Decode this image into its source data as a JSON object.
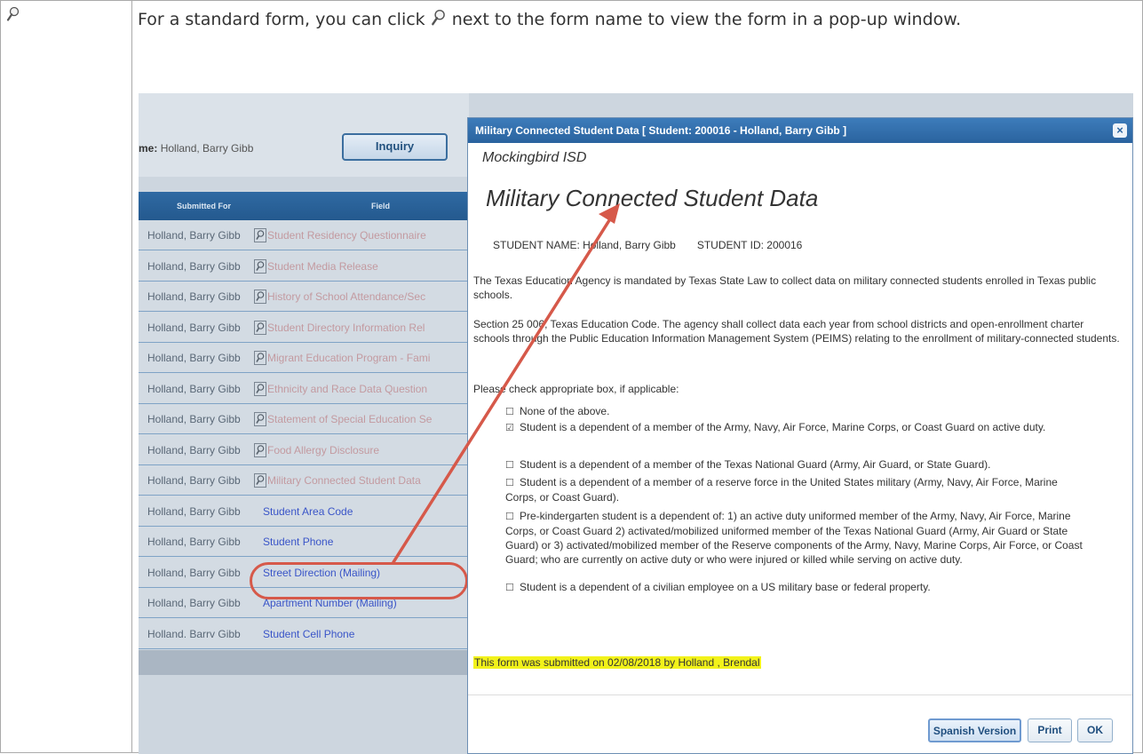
{
  "description": {
    "text_before": "For a standard form, you can click ",
    "text_after": " next to the form name to view the form in a pop-up window."
  },
  "background_page": {
    "student_label": "me:",
    "student_name": "Holland, Barry Gibb",
    "inquiry_button": "Inquiry",
    "grid_headers": {
      "submitted_for": "Submitted For",
      "field": "Field"
    },
    "rows": [
      {
        "who": "Holland, Barry Gibb",
        "field": "Student Residency Questionnaire",
        "icon": true
      },
      {
        "who": "Holland, Barry Gibb",
        "field": "Student Media Release",
        "icon": true
      },
      {
        "who": "Holland, Barry Gibb",
        "field": "History of School Attendance/Sec",
        "icon": true
      },
      {
        "who": "Holland, Barry Gibb",
        "field": "Student Directory Information Rel",
        "icon": true
      },
      {
        "who": "Holland, Barry Gibb",
        "field": "Migrant Education Program - Fami",
        "icon": true
      },
      {
        "who": "Holland, Barry Gibb",
        "field": "Ethnicity and Race Data Question",
        "icon": true
      },
      {
        "who": "Holland, Barry Gibb",
        "field": "Statement of Special Education Se",
        "icon": true
      },
      {
        "who": "Holland, Barry Gibb",
        "field": "Food Allergy Disclosure",
        "icon": true
      },
      {
        "who": "Holland, Barry Gibb",
        "field": "Military Connected Student Data",
        "icon": true
      },
      {
        "who": "Holland, Barry Gibb",
        "field": "Student Area Code",
        "icon": false
      },
      {
        "who": "Holland, Barry Gibb",
        "field": "Student Phone",
        "icon": false
      },
      {
        "who": "Holland, Barry Gibb",
        "field": "Street Direction (Mailing)",
        "icon": false
      },
      {
        "who": "Holland, Barry Gibb",
        "field": "Apartment Number (Mailing)",
        "icon": false
      },
      {
        "who": "Holland. Barrv Gibb",
        "field": "Student Cell Phone",
        "icon": false
      }
    ]
  },
  "dialog": {
    "title": "Military Connected Student Data [ Student: 200016 - Holland, Barry Gibb ]",
    "close_glyph": "×",
    "district": "Mockingbird ISD",
    "form_title": "Military Connected Student Data",
    "student_name": "STUDENT NAME: Holland, Barry Gibb",
    "student_id": "STUDENT ID: 200016",
    "para1": "The Texas Education Agency is mandated by Texas State Law to collect data on military connected students enrolled in Texas public schools.",
    "para2": "Section 25 006, Texas Education Code. The agency shall collect data each year from school districts and open-enrollment charter schools through the Public Education Information Management System (PEIMS) relating to the enrollment of military-connected students.",
    "prompt": "Please check appropriate box, if applicable:",
    "options": [
      {
        "checked": false,
        "text": "None of the above."
      },
      {
        "checked": true,
        "text": "Student is a dependent of a member of the Army, Navy, Air Force, Marine Corps, or Coast Guard on active duty."
      },
      {
        "checked": false,
        "text": "Student is a dependent of a member of the Texas National Guard (Army, Air Guard, or State Guard)."
      },
      {
        "checked": false,
        "text": "Student is a dependent of a member of a reserve force in the United States military (Army, Navy, Air Force, Marine Corps, or Coast Guard)."
      },
      {
        "checked": false,
        "text": "Pre-kindergarten student is a dependent of: 1) an active duty uniformed member of the Army, Navy, Air Force, Marine Corps, or Coast Guard 2) activated/mobilized uniformed member of the Texas National Guard (Army, Air Guard or State Guard) or 3) activated/mobilized member of the Reserve components of the Army, Navy, Marine Corps, Air Force, or Coast Guard; who are currently on active duty or who were injured or killed while serving on active duty."
      },
      {
        "checked": false,
        "text": "Student is a dependent of a civilian employee on a US military base or federal property."
      }
    ],
    "submitted": "This form was submitted on 02/08/2018 by Holland , Brendal",
    "buttons": {
      "spanish": "Spanish Version",
      "print": "Print",
      "ok": "OK"
    }
  },
  "colors": {
    "annotation": "#d6594a",
    "header_blue": "#2a639f"
  }
}
